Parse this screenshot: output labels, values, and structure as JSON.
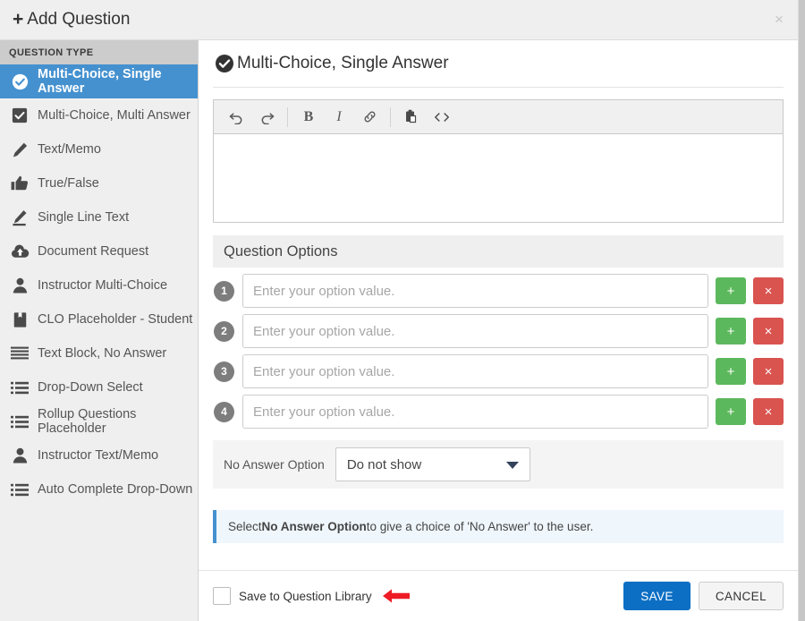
{
  "header": {
    "title": "Add Question",
    "plus_icon": "plus-icon",
    "close_label": "×"
  },
  "sidebar": {
    "header": "QUESTION TYPE",
    "items": [
      {
        "label": "Multi-Choice, Single Answer",
        "icon": "check-circle-icon",
        "active": true
      },
      {
        "label": "Multi-Choice, Multi Answer",
        "icon": "check-square-icon",
        "active": false
      },
      {
        "label": "Text/Memo",
        "icon": "pencil-icon",
        "active": false
      },
      {
        "label": "True/False",
        "icon": "thumbs-up-icon",
        "active": false
      },
      {
        "label": "Single Line Text",
        "icon": "pencil-underline-icon",
        "active": false
      },
      {
        "label": "Document Request",
        "icon": "cloud-upload-icon",
        "active": false
      },
      {
        "label": "Instructor Multi-Choice",
        "icon": "person-icon",
        "active": false
      },
      {
        "label": "CLO Placeholder - Student",
        "icon": "bookmark-icon",
        "active": false
      },
      {
        "label": "Text Block, No Answer",
        "icon": "align-justify-icon",
        "active": false
      },
      {
        "label": "Drop-Down Select",
        "icon": "list-icon",
        "active": false
      },
      {
        "label": "Rollup Questions Placeholder",
        "icon": "list-icon",
        "active": false
      },
      {
        "label": "Instructor Text/Memo",
        "icon": "person-icon",
        "active": false
      },
      {
        "label": "Auto Complete Drop-Down",
        "icon": "list-icon",
        "active": false
      }
    ]
  },
  "panel": {
    "title": "Multi-Choice, Single Answer",
    "title_icon": "check-circle-icon"
  },
  "editor": {
    "toolbar": [
      {
        "name": "undo-icon",
        "label": "undo"
      },
      {
        "name": "redo-icon",
        "label": "redo"
      },
      {
        "name": "bold-icon",
        "label": "B"
      },
      {
        "name": "italic-icon",
        "label": "I"
      },
      {
        "name": "link-icon",
        "label": "link"
      },
      {
        "name": "paste-icon",
        "label": "paste"
      },
      {
        "name": "code-icon",
        "label": "<>"
      }
    ],
    "content": ""
  },
  "question_options": {
    "heading": "Question Options",
    "rows": [
      {
        "number": "1",
        "value": "",
        "placeholder": "Enter your option value.",
        "add_label": "+",
        "delete_label": "×"
      },
      {
        "number": "2",
        "value": "",
        "placeholder": "Enter your option value.",
        "add_label": "+",
        "delete_label": "×"
      },
      {
        "number": "3",
        "value": "",
        "placeholder": "Enter your option value.",
        "add_label": "+",
        "delete_label": "×"
      },
      {
        "number": "4",
        "value": "",
        "placeholder": "Enter your option value.",
        "add_label": "+",
        "delete_label": "×"
      }
    ]
  },
  "no_answer": {
    "label": "No Answer Option",
    "selected": "Do not show"
  },
  "info": {
    "prefix": "Select ",
    "bold": "No Answer Option",
    "suffix": " to give a choice of 'No Answer' to the user."
  },
  "footer": {
    "checkbox_label": "Save to Question Library",
    "annotation_icon": "red-left-arrow-icon",
    "save_label": "SAVE",
    "cancel_label": "CANCEL"
  },
  "colors": {
    "accent_blue": "#4591cf",
    "save_blue": "#0d6fc4",
    "add_green": "#5cb85c",
    "delete_red": "#d9534f",
    "annotation_red": "#ee1c25",
    "sidebar_bg": "#efefef",
    "sidebar_header_bg": "#cccccc"
  }
}
